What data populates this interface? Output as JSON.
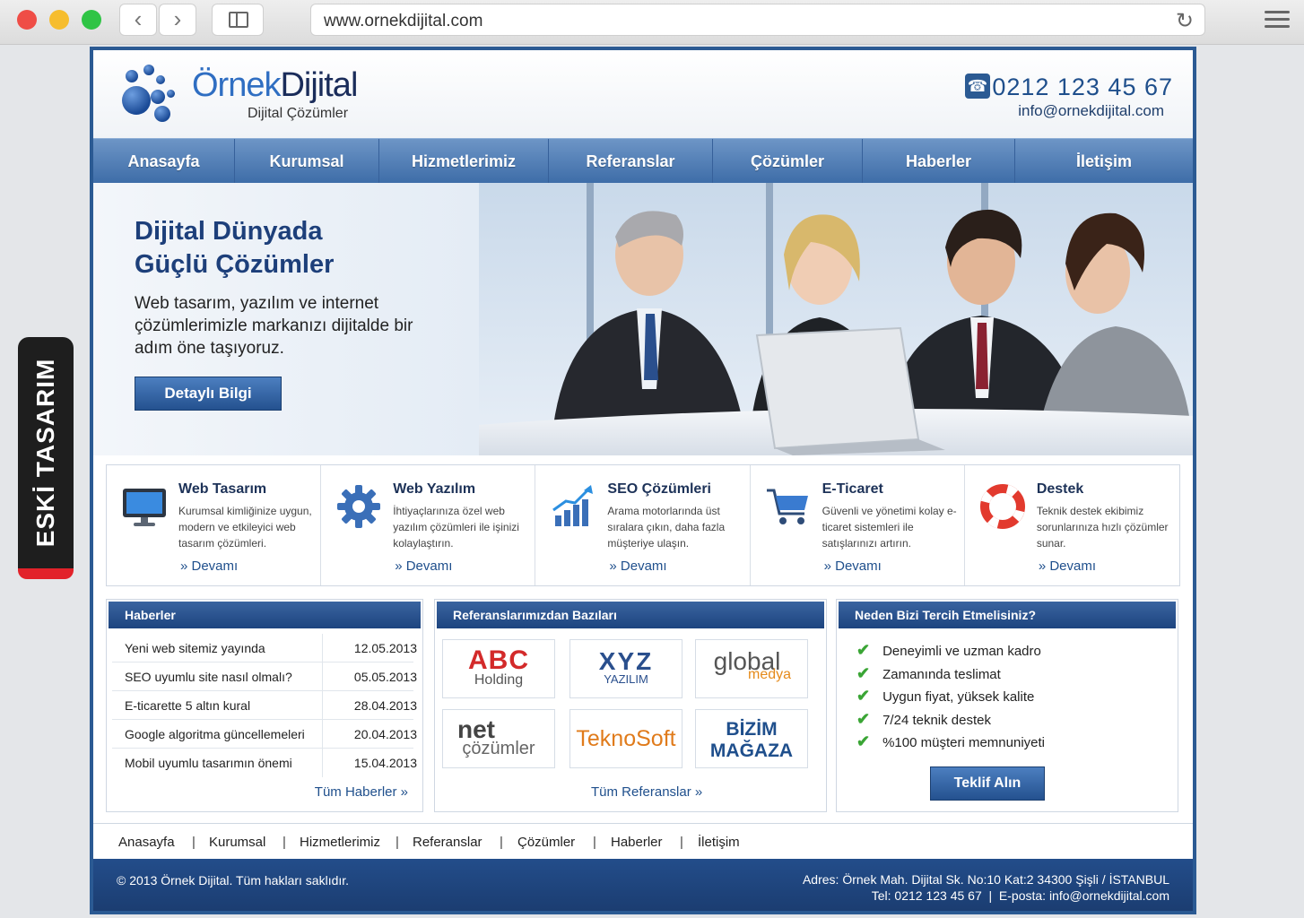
{
  "browser": {
    "url": "www.ornekdijital.com"
  },
  "side_tag": "ESKİ TASARIM",
  "header": {
    "brand_part1": "Örnek",
    "brand_part2": "Dijital",
    "tagline": "Dijital Çözümler",
    "phone": "0212 123 45 67",
    "email": "info@ornekdijital.com"
  },
  "nav": [
    {
      "label": "Anasayfa"
    },
    {
      "label": "Kurumsal"
    },
    {
      "label": "Hizmetlerimiz"
    },
    {
      "label": "Referanslar"
    },
    {
      "label": "Çözümler"
    },
    {
      "label": "Haberler"
    },
    {
      "label": "İletişim"
    }
  ],
  "hero": {
    "title_line1": "Dijital Dünyada",
    "title_line2": "Güçlü Çözümler",
    "text": "Web tasarım, yazılım ve internet çözümlerimizle markanızı dijitalde bir adım öne taşıyoruz.",
    "button": "Detaylı Bilgi"
  },
  "services": [
    {
      "icon": "monitor-icon",
      "title": "Web Tasarım",
      "desc": "Kurumsal kimliğinize uygun, modern ve etkileyici web tasarım çözümleri.",
      "more": "» Devamı"
    },
    {
      "icon": "gear-icon",
      "title": "Web Yazılım",
      "desc": "İhtiyaçlarınıza özel web yazılım çözümleri ile işinizi kolaylaştırın.",
      "more": "» Devamı"
    },
    {
      "icon": "growth-chart-icon",
      "title": "SEO Çözümleri",
      "desc": "Arama motorlarında üst sıralara çıkın, daha fazla müşteriye ulaşın.",
      "more": "» Devamı"
    },
    {
      "icon": "shopping-cart-icon",
      "title": "E-Ticaret",
      "desc": "Güvenli ve yönetimi kolay e-ticaret sistemleri ile satışlarınızı artırın.",
      "more": "» Devamı"
    },
    {
      "icon": "lifebuoy-icon",
      "title": "Destek",
      "desc": "Teknik destek ekibimiz sorunlarınıza hızlı çözümler sunar.",
      "more": "» Devamı"
    }
  ],
  "news": {
    "title": "Haberler",
    "items": [
      {
        "title": "Yeni web sitemiz yayında",
        "date": "12.05.2013"
      },
      {
        "title": "SEO uyumlu site nasıl olmalı?",
        "date": "05.05.2013"
      },
      {
        "title": "E-ticarette 5 altın kural",
        "date": "28.04.2013"
      },
      {
        "title": "Google algoritma güncellemeleri",
        "date": "20.04.2013"
      },
      {
        "title": "Mobil uyumlu tasarımın önemi",
        "date": "15.04.2013"
      }
    ],
    "more": "Tüm Haberler »"
  },
  "references": {
    "title": "Referanslarımızdan Bazıları",
    "logos": [
      {
        "line1": "ABC",
        "line2": "Holding"
      },
      {
        "line1": "XYZ",
        "line2": "YAZILIM"
      },
      {
        "line1": "global",
        "line2": "medya"
      },
      {
        "line1": "net",
        "line2": "çözümler"
      },
      {
        "line1": "TeknoSoft",
        "line2": ""
      },
      {
        "line1": "BİZİM",
        "line2": "MAĞAZA"
      }
    ],
    "more": "Tüm Referanslar »"
  },
  "why": {
    "title": "Neden Bizi Tercih Etmelisiniz?",
    "items": [
      "Deneyimli ve uzman kadro",
      "Zamanında teslimat",
      "Uygun fiyat, yüksek kalite",
      "7/24 teknik destek",
      "%100 müşteri memnuniyeti"
    ],
    "button": "Teklif Alın"
  },
  "footer_nav": [
    "Anasayfa",
    "Kurumsal",
    "Hizmetlerimiz",
    "Referanslar",
    "Çözümler",
    "Haberler",
    "İletişim"
  ],
  "footer": {
    "copyright": "© 2013 Örnek Dijital. Tüm hakları saklıdır.",
    "address": "Adres: Örnek Mah. Dijital Sk. No:10 Kat:2 34300 Şişli / İSTANBUL",
    "contact": "Tel: 0212 123 45 67  |  E-posta: info@ornekdijital.com"
  }
}
